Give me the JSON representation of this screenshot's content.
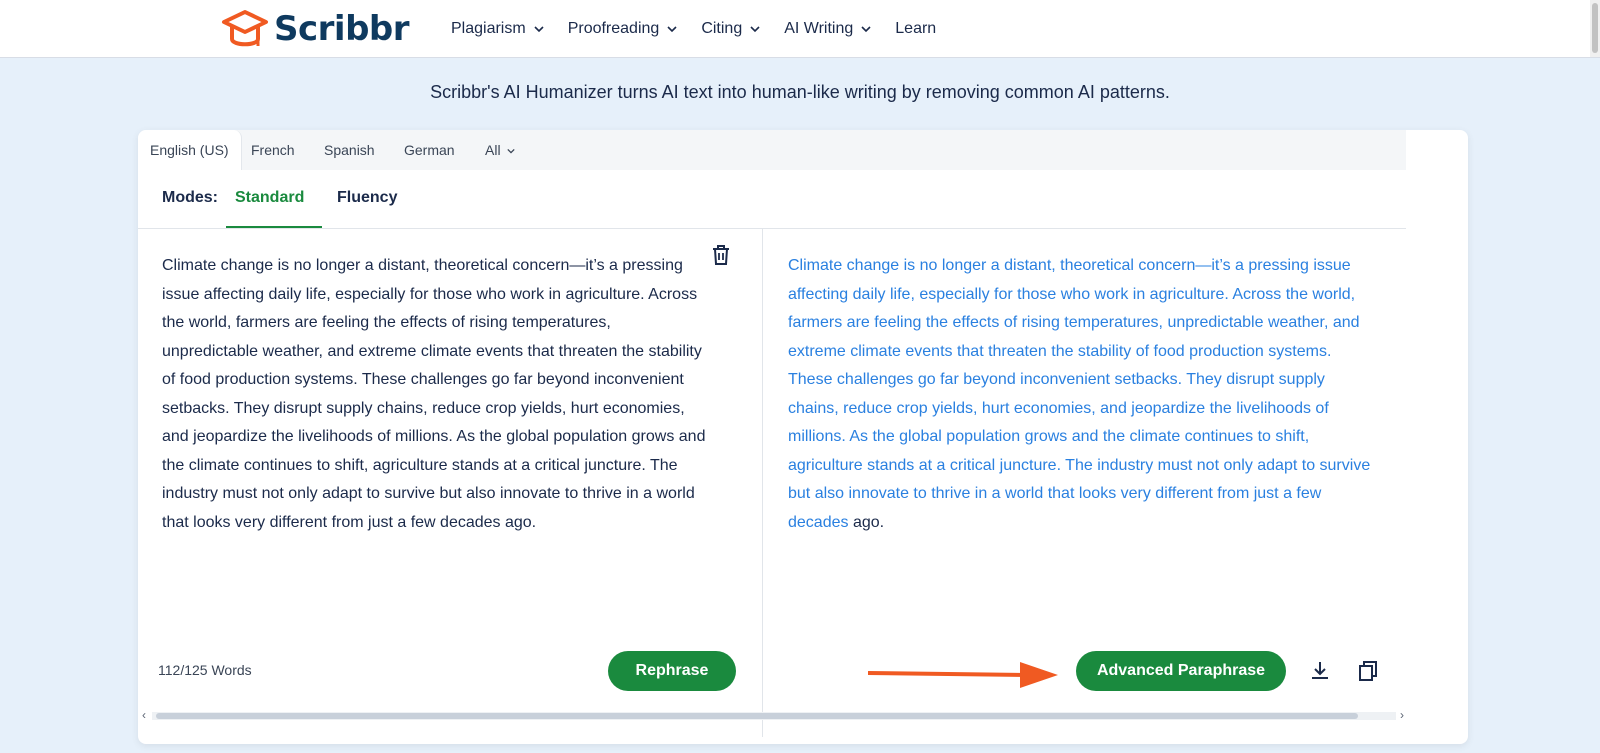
{
  "brand": {
    "name": "Scribbr",
    "logo_icon": "graduation-cap-icon",
    "accent": "#f05a22"
  },
  "nav": {
    "items": [
      {
        "label": "Plagiarism",
        "has_dropdown": true
      },
      {
        "label": "Proofreading",
        "has_dropdown": true
      },
      {
        "label": "Citing",
        "has_dropdown": true
      },
      {
        "label": "AI Writing",
        "has_dropdown": true
      },
      {
        "label": "Learn",
        "has_dropdown": false
      }
    ]
  },
  "tagline": "Scribbr's AI Humanizer turns AI text into human-like writing by removing common AI patterns.",
  "languages": {
    "tabs": [
      "English (US)",
      "French",
      "Spanish",
      "German",
      "All"
    ],
    "active": "English (US)"
  },
  "modes": {
    "label": "Modes:",
    "tabs": [
      "Standard",
      "Fluency"
    ],
    "active": "Standard"
  },
  "input": {
    "text": "Climate change is no longer a distant, theoretical concern—it’s a pressing issue affecting daily life, especially for those who work in agriculture. Across the world, farmers are feeling the effects of rising temperatures, unpredictable weather, and extreme climate events that threaten the stability of food production systems. These challenges go far beyond inconvenient setbacks. They disrupt supply chains, reduce crop yields, hurt economies, and jeopardize the livelihoods of millions. As the global population grows and the climate continues to shift, agriculture stands at a critical juncture. The industry must not only adapt to survive but also innovate to thrive in a world that looks very different from just a few decades ago.",
    "word_count": "112/125 Words",
    "rephrase_label": "Rephrase"
  },
  "output": {
    "text": "Climate change is no longer a distant, theoretical concern—it’s a pressing issue affecting daily life, especially for those who work in agriculture. Across the world, farmers are feeling the effects of rising temperatures, unpredictable weather, and extreme climate events that threaten the stability of food production systems. These challenges go far beyond inconvenient setbacks. They disrupt supply chains, reduce crop yields, hurt economies, and jeopardize the livelihoods of millions. As the global population grows and the climate continues to shift, agriculture stands at a critical juncture. The industry must not only adapt to survive but also innovate to thrive in a world that looks very different from just a few decades",
    "tail": " ago.",
    "changed_color": "#2a80e0",
    "advanced_label": "Advanced Paraphrase"
  },
  "colors": {
    "primary_green": "#1a8a3e",
    "annotation_arrow": "#f05a22"
  }
}
